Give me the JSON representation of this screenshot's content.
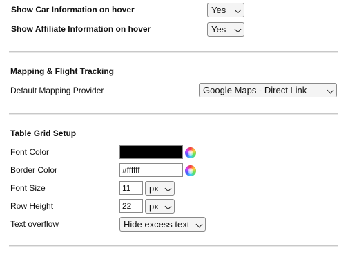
{
  "hover": {
    "car_label": "Show Car Information on hover",
    "car_value": "Yes",
    "affiliate_label": "Show Affiliate Information on hover",
    "affiliate_value": "Yes"
  },
  "mapping": {
    "heading": "Mapping & Flight Tracking",
    "provider_label": "Default Mapping Provider",
    "provider_value": "Google Maps - Direct Link"
  },
  "grid": {
    "heading": "Table Grid Setup",
    "font_color_label": "Font Color",
    "font_color_value": "#000000",
    "border_color_label": "Border Color",
    "border_color_value": "#ffffff",
    "font_size_label": "Font Size",
    "font_size_value": "11",
    "font_size_unit": "px",
    "row_height_label": "Row Height",
    "row_height_value": "22",
    "row_height_unit": "px",
    "overflow_label": "Text overflow",
    "overflow_value": "Hide excess text"
  },
  "icons": {
    "color_picker": "color-wheel-icon",
    "dropdown": "chevron-down-icon"
  }
}
